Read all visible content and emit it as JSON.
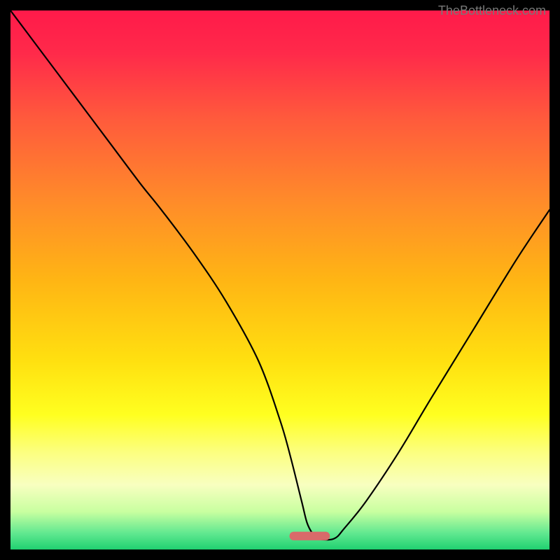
{
  "watermark": "TheBottleneck.com",
  "dims": {
    "page": 800,
    "plot": 770,
    "margin": 15
  },
  "gradient_stops": [
    {
      "offset": 0.0,
      "color": "#ff1a4a"
    },
    {
      "offset": 0.08,
      "color": "#ff2a4a"
    },
    {
      "offset": 0.2,
      "color": "#ff5a3c"
    },
    {
      "offset": 0.35,
      "color": "#ff8a2a"
    },
    {
      "offset": 0.5,
      "color": "#ffb514"
    },
    {
      "offset": 0.65,
      "color": "#ffe010"
    },
    {
      "offset": 0.75,
      "color": "#ffff20"
    },
    {
      "offset": 0.82,
      "color": "#fcff80"
    },
    {
      "offset": 0.88,
      "color": "#f8ffc0"
    },
    {
      "offset": 0.93,
      "color": "#c8ffa0"
    },
    {
      "offset": 0.97,
      "color": "#60e890"
    },
    {
      "offset": 1.0,
      "color": "#20d070"
    }
  ],
  "marker": {
    "x_frac": 0.555,
    "y_frac": 0.975,
    "w_frac": 0.075,
    "h_frac": 0.016,
    "color": "#d96a6a"
  },
  "chart_data": {
    "type": "line",
    "title": "",
    "xlabel": "",
    "ylabel": "",
    "xlim": [
      0,
      100
    ],
    "ylim": [
      0,
      100
    ],
    "series": [
      {
        "name": "curve",
        "x": [
          0,
          6,
          12,
          18,
          24,
          28,
          34,
          40,
          46,
          50,
          52,
          54,
          55,
          56,
          57,
          60,
          62,
          66,
          72,
          78,
          86,
          94,
          100
        ],
        "values": [
          100,
          92,
          84,
          76,
          68,
          63,
          55,
          46,
          35,
          24,
          17,
          9,
          5,
          3,
          2,
          2,
          4,
          9,
          18,
          28,
          41,
          54,
          63
        ]
      }
    ],
    "note": "x and values are relative percentages of the plot area; values = height above bottom; used to draw the black V-shaped curve"
  }
}
